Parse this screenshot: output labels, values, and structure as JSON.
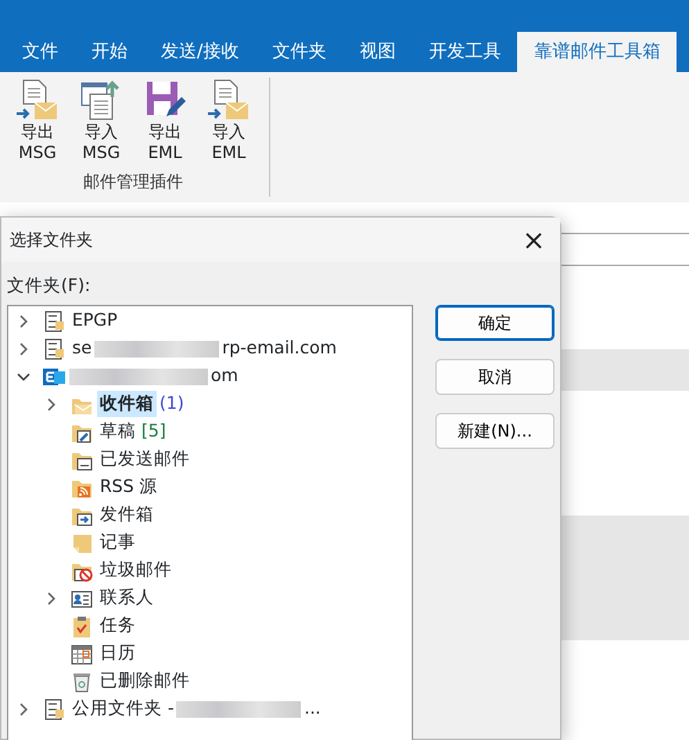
{
  "ribbon": {
    "tabs": [
      {
        "label": "文件",
        "selected": false
      },
      {
        "label": "开始",
        "selected": false
      },
      {
        "label": "发送/接收",
        "selected": false
      },
      {
        "label": "文件夹",
        "selected": false
      },
      {
        "label": "视图",
        "selected": false
      },
      {
        "label": "开发工具",
        "selected": false
      },
      {
        "label": "靠谱邮件工具箱",
        "selected": true
      }
    ],
    "buttons": [
      {
        "kind": "export",
        "label": "导出 MSG"
      },
      {
        "kind": "import",
        "label": "导入 MSG"
      },
      {
        "kind": "save",
        "label": "导出 EML"
      },
      {
        "kind": "export",
        "label": "导入 EML"
      }
    ],
    "group_label": "邮件管理插件"
  },
  "dialog": {
    "title": "选择文件夹",
    "close": "×",
    "folder_label": "文件夹(F):",
    "tree": [
      {
        "kind": "store",
        "label": "EPGP",
        "redacted": false,
        "expanded": false,
        "has_children": true
      },
      {
        "kind": "store",
        "label": "se",
        "label_end": "rp-email.com",
        "redacted": true,
        "expanded": false,
        "has_children": true
      },
      {
        "kind": "exchange",
        "label_end": "om",
        "redacted": true,
        "expanded": true,
        "has_children": true,
        "children": [
          {
            "kind": "inbox",
            "label": "收件箱",
            "count": "(1)",
            "color": "#3b46d6",
            "selected": true,
            "has_children": true,
            "expanded": false
          },
          {
            "kind": "drafts",
            "label": "草稿",
            "count": "[5]",
            "color": "#16803c",
            "selected": false,
            "has_children": false
          },
          {
            "kind": "sent",
            "label": "已发送邮件",
            "selected": false,
            "has_children": false
          },
          {
            "kind": "rss",
            "label": "RSS 源",
            "selected": false,
            "has_children": false
          },
          {
            "kind": "outbox",
            "label": "发件箱",
            "selected": false,
            "has_children": false
          },
          {
            "kind": "notes",
            "label": "记事",
            "selected": false,
            "has_children": false
          },
          {
            "kind": "junk",
            "label": "垃圾邮件",
            "selected": false,
            "has_children": false
          },
          {
            "kind": "contacts",
            "label": "联系人",
            "selected": false,
            "has_children": true,
            "expanded": false
          },
          {
            "kind": "tasks",
            "label": "任务",
            "selected": false,
            "has_children": false
          },
          {
            "kind": "calendar",
            "label": "日历",
            "selected": false,
            "has_children": false
          },
          {
            "kind": "trash",
            "label": "已删除邮件",
            "selected": false,
            "has_children": false
          }
        ]
      },
      {
        "kind": "store",
        "label": "公用文件夹 - ",
        "label_end": "...",
        "redacted": true,
        "expanded": false,
        "has_children": true
      }
    ],
    "buttons": [
      {
        "label": "确定",
        "default": true
      },
      {
        "label": "取消",
        "default": false
      },
      {
        "label": "新建(N)...",
        "default": false
      }
    ]
  }
}
